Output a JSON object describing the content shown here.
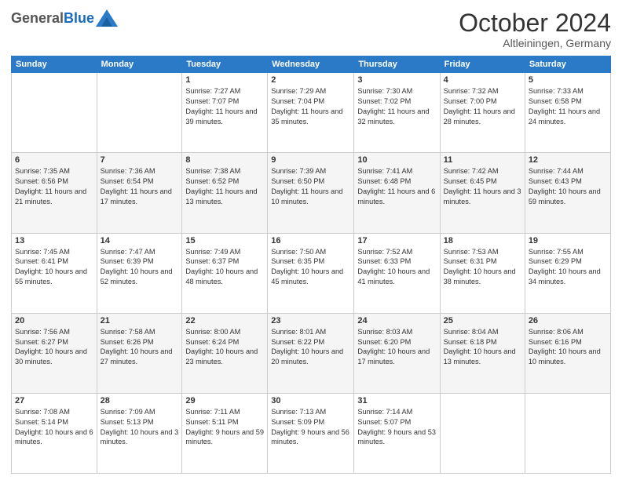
{
  "header": {
    "logo_general": "General",
    "logo_blue": "Blue",
    "month_title": "October 2024",
    "location": "Altleiningen, Germany"
  },
  "weekdays": [
    "Sunday",
    "Monday",
    "Tuesday",
    "Wednesday",
    "Thursday",
    "Friday",
    "Saturday"
  ],
  "weeks": [
    [
      {
        "day": "",
        "info": ""
      },
      {
        "day": "",
        "info": ""
      },
      {
        "day": "1",
        "info": "Sunrise: 7:27 AM\nSunset: 7:07 PM\nDaylight: 11 hours and 39 minutes."
      },
      {
        "day": "2",
        "info": "Sunrise: 7:29 AM\nSunset: 7:04 PM\nDaylight: 11 hours and 35 minutes."
      },
      {
        "day": "3",
        "info": "Sunrise: 7:30 AM\nSunset: 7:02 PM\nDaylight: 11 hours and 32 minutes."
      },
      {
        "day": "4",
        "info": "Sunrise: 7:32 AM\nSunset: 7:00 PM\nDaylight: 11 hours and 28 minutes."
      },
      {
        "day": "5",
        "info": "Sunrise: 7:33 AM\nSunset: 6:58 PM\nDaylight: 11 hours and 24 minutes."
      }
    ],
    [
      {
        "day": "6",
        "info": "Sunrise: 7:35 AM\nSunset: 6:56 PM\nDaylight: 11 hours and 21 minutes."
      },
      {
        "day": "7",
        "info": "Sunrise: 7:36 AM\nSunset: 6:54 PM\nDaylight: 11 hours and 17 minutes."
      },
      {
        "day": "8",
        "info": "Sunrise: 7:38 AM\nSunset: 6:52 PM\nDaylight: 11 hours and 13 minutes."
      },
      {
        "day": "9",
        "info": "Sunrise: 7:39 AM\nSunset: 6:50 PM\nDaylight: 11 hours and 10 minutes."
      },
      {
        "day": "10",
        "info": "Sunrise: 7:41 AM\nSunset: 6:48 PM\nDaylight: 11 hours and 6 minutes."
      },
      {
        "day": "11",
        "info": "Sunrise: 7:42 AM\nSunset: 6:45 PM\nDaylight: 11 hours and 3 minutes."
      },
      {
        "day": "12",
        "info": "Sunrise: 7:44 AM\nSunset: 6:43 PM\nDaylight: 10 hours and 59 minutes."
      }
    ],
    [
      {
        "day": "13",
        "info": "Sunrise: 7:45 AM\nSunset: 6:41 PM\nDaylight: 10 hours and 55 minutes."
      },
      {
        "day": "14",
        "info": "Sunrise: 7:47 AM\nSunset: 6:39 PM\nDaylight: 10 hours and 52 minutes."
      },
      {
        "day": "15",
        "info": "Sunrise: 7:49 AM\nSunset: 6:37 PM\nDaylight: 10 hours and 48 minutes."
      },
      {
        "day": "16",
        "info": "Sunrise: 7:50 AM\nSunset: 6:35 PM\nDaylight: 10 hours and 45 minutes."
      },
      {
        "day": "17",
        "info": "Sunrise: 7:52 AM\nSunset: 6:33 PM\nDaylight: 10 hours and 41 minutes."
      },
      {
        "day": "18",
        "info": "Sunrise: 7:53 AM\nSunset: 6:31 PM\nDaylight: 10 hours and 38 minutes."
      },
      {
        "day": "19",
        "info": "Sunrise: 7:55 AM\nSunset: 6:29 PM\nDaylight: 10 hours and 34 minutes."
      }
    ],
    [
      {
        "day": "20",
        "info": "Sunrise: 7:56 AM\nSunset: 6:27 PM\nDaylight: 10 hours and 30 minutes."
      },
      {
        "day": "21",
        "info": "Sunrise: 7:58 AM\nSunset: 6:26 PM\nDaylight: 10 hours and 27 minutes."
      },
      {
        "day": "22",
        "info": "Sunrise: 8:00 AM\nSunset: 6:24 PM\nDaylight: 10 hours and 23 minutes."
      },
      {
        "day": "23",
        "info": "Sunrise: 8:01 AM\nSunset: 6:22 PM\nDaylight: 10 hours and 20 minutes."
      },
      {
        "day": "24",
        "info": "Sunrise: 8:03 AM\nSunset: 6:20 PM\nDaylight: 10 hours and 17 minutes."
      },
      {
        "day": "25",
        "info": "Sunrise: 8:04 AM\nSunset: 6:18 PM\nDaylight: 10 hours and 13 minutes."
      },
      {
        "day": "26",
        "info": "Sunrise: 8:06 AM\nSunset: 6:16 PM\nDaylight: 10 hours and 10 minutes."
      }
    ],
    [
      {
        "day": "27",
        "info": "Sunrise: 7:08 AM\nSunset: 5:14 PM\nDaylight: 10 hours and 6 minutes."
      },
      {
        "day": "28",
        "info": "Sunrise: 7:09 AM\nSunset: 5:13 PM\nDaylight: 10 hours and 3 minutes."
      },
      {
        "day": "29",
        "info": "Sunrise: 7:11 AM\nSunset: 5:11 PM\nDaylight: 9 hours and 59 minutes."
      },
      {
        "day": "30",
        "info": "Sunrise: 7:13 AM\nSunset: 5:09 PM\nDaylight: 9 hours and 56 minutes."
      },
      {
        "day": "31",
        "info": "Sunrise: 7:14 AM\nSunset: 5:07 PM\nDaylight: 9 hours and 53 minutes."
      },
      {
        "day": "",
        "info": ""
      },
      {
        "day": "",
        "info": ""
      }
    ]
  ]
}
